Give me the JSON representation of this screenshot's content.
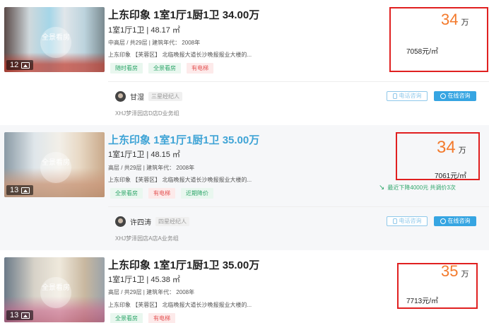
{
  "colors": {
    "accent": "#36a5e2",
    "price": "#f37a2c",
    "highlight_box": "#e02020",
    "tag_green": "#2ea66a",
    "tag_red": "#e45555"
  },
  "listings": [
    {
      "title": "上东印象 1室1厅1厨1卫 34.00万",
      "layout": "1室1厅1卫 | 48.17 ㎡",
      "meta": "中高层 / 共29层 | 建筑年代： 2008年",
      "address": "上东印象 【芙蓉区】 北临晚报大道长沙晚报报业大楼的...",
      "tags": [
        "随时看房",
        "全景看房",
        "有电梯"
      ],
      "price": "34",
      "price_unit": "万",
      "unit_price": "7058元/㎡",
      "photo_count": "12",
      "vr_label": "全景看房",
      "agent": {
        "name": "甘湿",
        "level": "三星经纪人",
        "store": "XHJ梦泽园店D店D业务组"
      },
      "phone_btn": "电话咨询",
      "online_btn": "在线咨询"
    },
    {
      "title": "上东印象 1室1厅1厨1卫 35.00万",
      "layout": "1室1厅1卫 | 48.15 ㎡",
      "meta": "高层 / 共29层 | 建筑年代： 2008年",
      "address": "上东印象 【芙蓉区】 北临晚报大道长沙晚报报业大楼的...",
      "tags": [
        "全景看房",
        "有电梯",
        "近期降价"
      ],
      "price": "34",
      "price_unit": "万",
      "unit_price": "7061元/㎡",
      "price_drop": "最近下降4000元  共调价3次",
      "photo_count": "13",
      "vr_label": "全景看房",
      "agent": {
        "name": "许四涛",
        "level": "四星经纪人",
        "store": "XHJ梦泽园店A店A业务组"
      },
      "phone_btn": "电话咨询",
      "online_btn": "在线咨询"
    },
    {
      "title": "上东印象 1室1厅1厨1卫 35.00万",
      "layout": "1室1厅1卫 | 45.38 ㎡",
      "meta": "高层 / 共29层 | 建筑年代： 2008年",
      "address": "上东印象 【芙蓉区】 北临晚报大道长沙晚报报业大楼的...",
      "tags": [
        "全景看房",
        "有电梯"
      ],
      "price": "35",
      "price_unit": "万",
      "unit_price": "7713元/㎡",
      "photo_count": "13",
      "vr_label": "全景看房"
    }
  ]
}
